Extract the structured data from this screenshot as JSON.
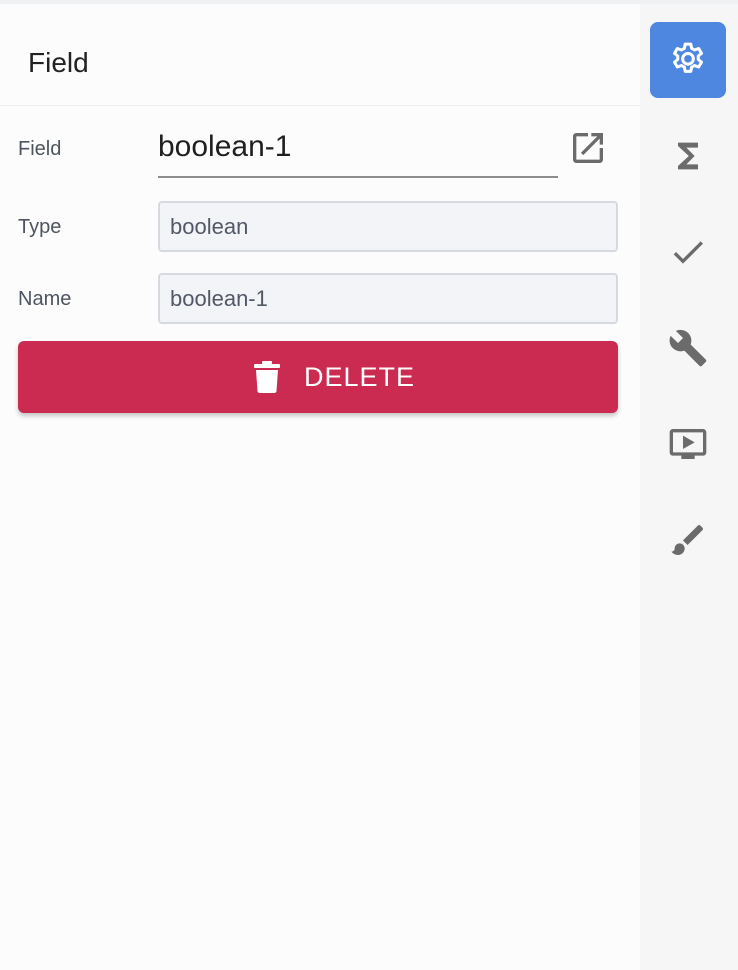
{
  "panel": {
    "title": "Field"
  },
  "form": {
    "field_label": "Field",
    "field_value": "boolean-1",
    "type_label": "Type",
    "type_value": "boolean",
    "name_label": "Name",
    "name_value": "boolean-1"
  },
  "actions": {
    "delete_label": "DELETE",
    "delete_color": "#cc2b51"
  },
  "sidebar": {
    "active_color": "#4e87e0",
    "items": [
      {
        "icon": "gear-icon",
        "active": true
      },
      {
        "icon": "sigma-icon",
        "active": false
      },
      {
        "icon": "check-icon",
        "active": false
      },
      {
        "icon": "wrench-icon",
        "active": false
      },
      {
        "icon": "slideshow-icon",
        "active": false
      },
      {
        "icon": "brush-icon",
        "active": false
      }
    ]
  }
}
